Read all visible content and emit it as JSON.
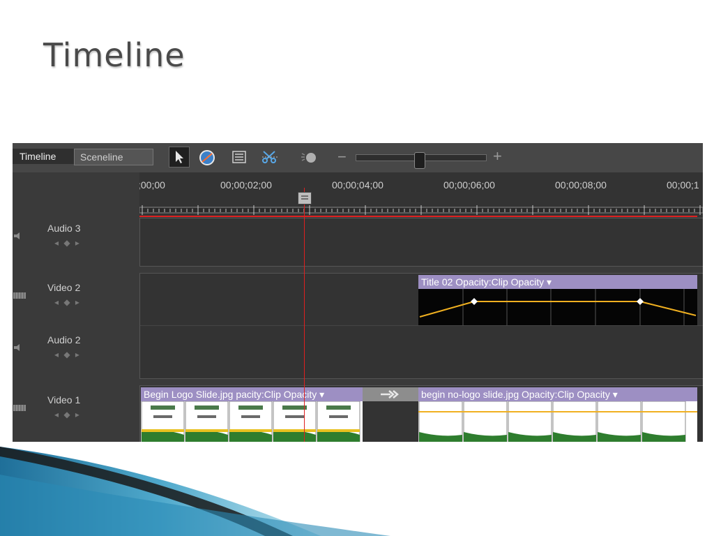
{
  "slide": {
    "title": "Timeline"
  },
  "tabs": {
    "timeline": "Timeline",
    "sceneline": "Sceneline"
  },
  "toolbar": {
    "tools": [
      "selection-tool",
      "time-stretch-tool",
      "properties-tool",
      "split-clip-tool",
      "smart-mix-tool"
    ],
    "zoom_minus": "−",
    "zoom_plus": "+",
    "zoom_level": 0.5
  },
  "ruler": {
    "timecodes": [
      ";00;00",
      "00;00;02;00",
      "00;00;04;00",
      "00;00;06;00",
      "00;00;08;00",
      "00;00;1"
    ]
  },
  "tracks": [
    {
      "name": "Audio 3",
      "icon": "speaker-icon",
      "nav": "◂ ◆ ▸"
    },
    {
      "name": "Video 2",
      "icon": "filmstrip-icon",
      "nav": "◂ ◆ ▸"
    },
    {
      "name": "Audio 2",
      "icon": "speaker-icon",
      "nav": "◂ ◆ ▸"
    },
    {
      "name": "Video 1",
      "icon": "filmstrip-icon",
      "nav": "◂ ◆ ▸"
    }
  ],
  "clips": {
    "title02": "Title 02  Opacity:Clip Opacity ▾",
    "begin_logo": "Begin Logo Slide.jpg  ",
    "begin_logo_overlay": "pacity:Clip Opacity ▾",
    "begin_nologo": "begin no-logo slide.jpg  Opacity:Clip Opacity ▾"
  },
  "colors": {
    "clip_header": "#9d8fc3",
    "playhead": "#e02020",
    "opacity_line": "#f0b020"
  }
}
